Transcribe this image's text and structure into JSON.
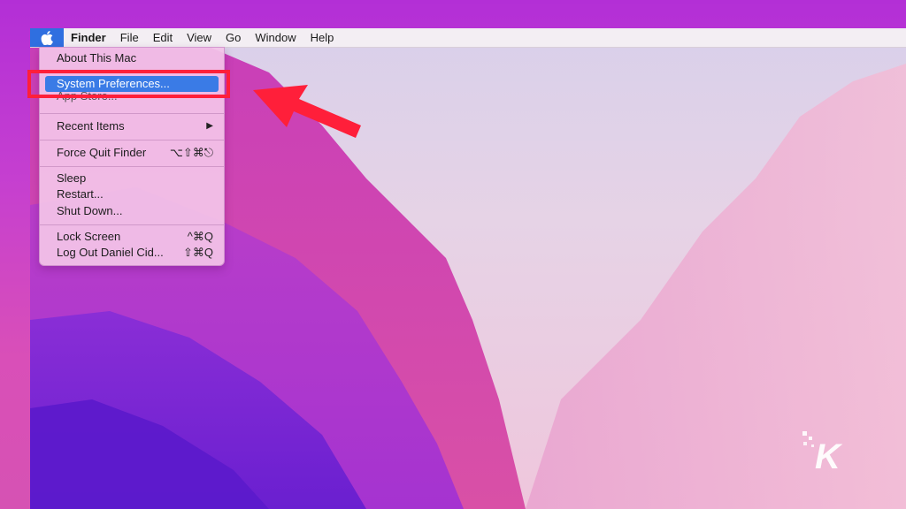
{
  "menubar": {
    "app_name": "Finder",
    "items": [
      "File",
      "Edit",
      "View",
      "Go",
      "Window",
      "Help"
    ]
  },
  "apple_menu": {
    "items": [
      {
        "label": "About This Mac",
        "shortcut": ""
      },
      {
        "label": "System Preferences...",
        "shortcut": ""
      },
      {
        "label": "App Store...",
        "shortcut": ""
      },
      {
        "label": "Recent Items",
        "shortcut": "▶"
      },
      {
        "label": "Force Quit Finder",
        "shortcut": "⌥⇧⌘⎋"
      },
      {
        "label": "Sleep",
        "shortcut": ""
      },
      {
        "label": "Restart...",
        "shortcut": ""
      },
      {
        "label": "Shut Down...",
        "shortcut": ""
      },
      {
        "label": "Lock Screen",
        "shortcut": "^⌘Q"
      },
      {
        "label": "Log Out Daniel Cid...",
        "shortcut": "⇧⌘Q"
      }
    ],
    "highlighted": "System Preferences..."
  },
  "annotation": {
    "box_color": "#ff1f3a",
    "arrow_color": "#ff1f3a"
  },
  "colors": {
    "accent": "#3a7be6",
    "apple_button": "#2f6fe0"
  },
  "watermark": {
    "letter": "K"
  }
}
